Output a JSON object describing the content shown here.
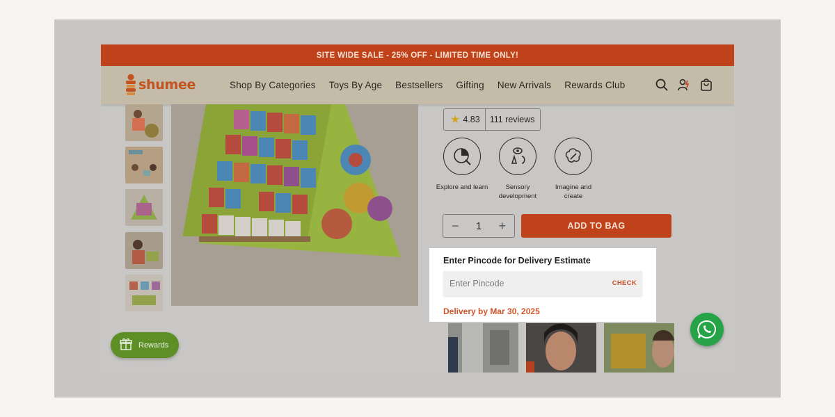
{
  "announcement": "SITE WIDE SALE - 25% OFF - LIMITED TIME ONLY!",
  "brand": "shumee",
  "nav": [
    "Shop By Categories",
    "Toys By Age",
    "Bestsellers",
    "Gifting",
    "New Arrivals",
    "Rewards Club"
  ],
  "header_icons": [
    "search-icon",
    "account-icon",
    "cart-icon"
  ],
  "rating": {
    "score": "4.83",
    "reviews": "111 reviews"
  },
  "features": [
    {
      "icon": "explore-icon",
      "label": "Explore and learn"
    },
    {
      "icon": "sensory-icon",
      "label": "Sensory development"
    },
    {
      "icon": "imagine-icon",
      "label": "Imagine and create"
    }
  ],
  "quantity": {
    "value": "1",
    "minus": "−",
    "plus": "+"
  },
  "add_to_bag": "ADD TO BAG",
  "pincode": {
    "title": "Enter Pincode for Delivery Estimate",
    "placeholder": "Enter Pincode",
    "check": "CHECK",
    "delivery": "Delivery by Mar 30, 2025"
  },
  "rewards_button": "Rewards",
  "colors": {
    "brand_orange": "#c0421b",
    "whatsapp_green": "#27a347",
    "rewards_green": "#5d8f26"
  }
}
